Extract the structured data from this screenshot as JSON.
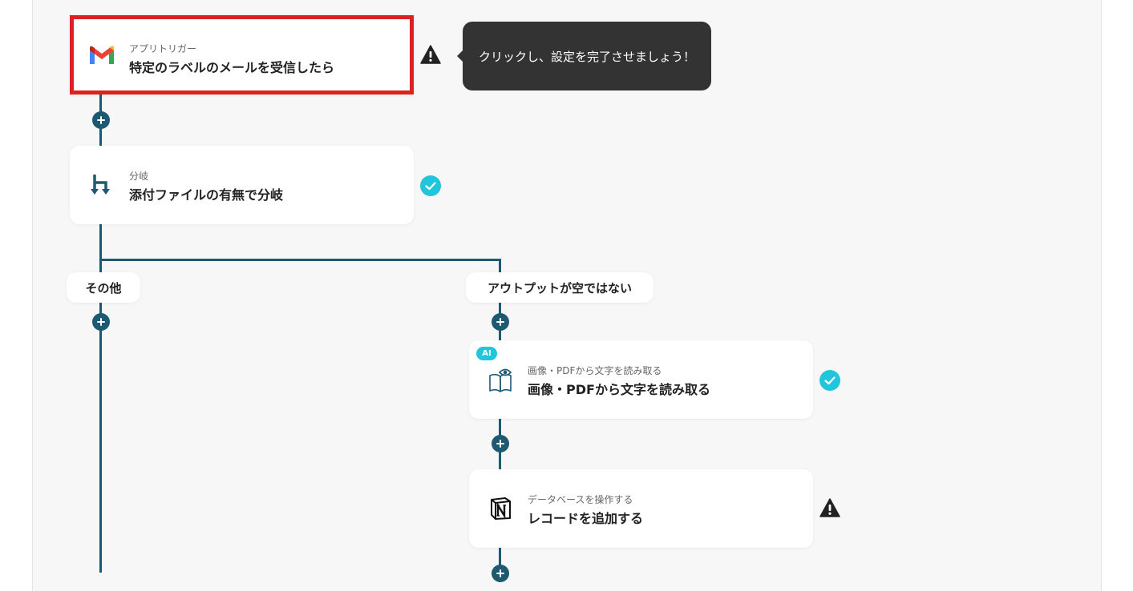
{
  "tooltip": {
    "text": "クリックし、設定を完了させましょう！"
  },
  "steps": [
    {
      "subtitle": "アプリトリガー",
      "title": "特定のラベルのメールを受信したら",
      "icon": "gmail-icon",
      "status": "warning"
    },
    {
      "subtitle": "分岐",
      "title": "添付ファイルの有無で分岐",
      "icon": "branch-icon",
      "status": "complete"
    },
    {
      "subtitle": "画像・PDFから文字を読み取る",
      "title": "画像・PDFから文字を読み取る",
      "icon": "ocr-book-icon",
      "badge": "AI",
      "status": "complete"
    },
    {
      "subtitle": "データベースを操作する",
      "title": "レコードを追加する",
      "icon": "notion-icon",
      "status": "warning"
    }
  ],
  "branches": {
    "left": "その他",
    "right": "アウトプットが空ではない"
  },
  "colors": {
    "connector": "#1d5a72",
    "highlight": "#dd2020",
    "complete": "#22c6dc",
    "warning": "#222222",
    "tooltip_bg": "#333333"
  }
}
